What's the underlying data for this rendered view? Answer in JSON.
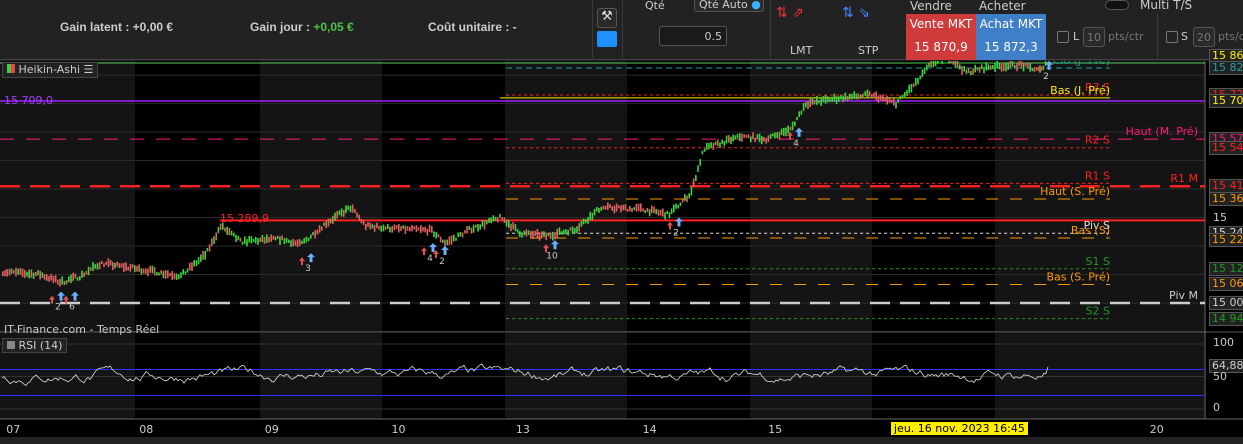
{
  "toolbar": {
    "gain_latent": "Gain latent : +0,00 €",
    "gain_jour_label": "Gain jour : ",
    "gain_jour_value": "+0,05 €",
    "cout_unitaire": "Coût unitaire : -",
    "qte_label": "Qté",
    "qte_auto": "Qté Auto",
    "qte_value": "0.5",
    "lmt": "LMT",
    "stp": "STP",
    "vendre": "Vendre",
    "acheter": "Acheter",
    "vente_mkt": "Vente MKT",
    "vente_price": "15 870,9",
    "achat_mkt": "Achat MKT",
    "achat_price": "15 872,3",
    "multi_ts": "Multi T/S",
    "l_label": "L",
    "l_value": "10",
    "s_label": "S",
    "s_value": "20",
    "pts_ctr": "pts/ctr"
  },
  "chart": {
    "type_label": "Heikin-Ashi",
    "source": "IT-Finance.com - Temps Réel",
    "rsi_label": "RSI (14)",
    "rsi_value": "64,88",
    "rsi_ticks": [
      "100",
      "50",
      "0"
    ],
    "level_left": "15 709,0",
    "level_mid": "15 289,9",
    "levels": [
      {
        "label": "Clo (J. Pré)",
        "price": 15825,
        "color": "#1aa3a3",
        "dash": "6,4",
        "from": 0.42
      },
      {
        "label": "R3 S",
        "price": 15730,
        "color": "#ff2020",
        "dash": "3,3",
        "from": 0.42
      },
      {
        "label": "Bas (J. Pré)",
        "price": 15720,
        "color": "#ffee00",
        "dash": "",
        "from": 1
      },
      {
        "label": "Haut (M. Pré)",
        "price": 15575,
        "color": "#ff1a80",
        "dash": "14,12",
        "from": 0
      },
      {
        "label": "R2 S",
        "price": 15545,
        "color": "#ff2020",
        "dash": "3,3",
        "from": 0.42
      },
      {
        "label": "R1 S",
        "price": 15420,
        "color": "#ff2020",
        "dash": "3,3",
        "from": 0.42
      },
      {
        "label": "R1 M",
        "price": 15410,
        "color": "#ff2020",
        "dash": "20,10",
        "from": 0
      },
      {
        "label": "Haut (S. Pré)",
        "price": 15365,
        "color": "#ff9900",
        "dash": "12,12",
        "from": 0.42
      },
      {
        "label": "Piv S",
        "price": 15245,
        "color": "#dddddd",
        "dash": "3,3",
        "from": 0.42
      },
      {
        "label": "Bas (S)",
        "price": 15228,
        "color": "#ff9900",
        "dash": "12,12",
        "from": 0.42
      },
      {
        "label": "S1 S",
        "price": 15120,
        "color": "#1f9a1f",
        "dash": "3,3",
        "from": 0.42
      },
      {
        "label": "Bas (S. Pré)",
        "price": 15065,
        "color": "#ff9900",
        "dash": "12,12",
        "from": 0.42
      },
      {
        "label": "Piv M",
        "price": 15000,
        "color": "#cccccc",
        "dash": "20,10",
        "from": 0
      },
      {
        "label": "S2 S",
        "price": 14945,
        "color": "#1f9a1f",
        "dash": "3,3",
        "from": 0.42
      }
    ],
    "price_boxes": [
      {
        "text": "15 86",
        "color": "#ffee00",
        "price": 15868
      },
      {
        "text": "15 82",
        "color": "#1aa3a3",
        "price": 15825
      },
      {
        "text": "15 72",
        "color": "#ff2020",
        "price": 15730
      },
      {
        "text": "15 70",
        "color": "#ffee00",
        "price": 15709
      },
      {
        "text": "15 57",
        "color": "#ff1a80",
        "price": 15575
      },
      {
        "text": "15 54",
        "color": "#ff2020",
        "price": 15545
      },
      {
        "text": "15 41",
        "color": "#ff2020",
        "price": 15410
      },
      {
        "text": "15 36",
        "color": "#ff9900",
        "price": 15365
      },
      {
        "text": "15 30",
        "color": "#cccccc",
        "price": 15300,
        "plain": true
      },
      {
        "text": "15 24",
        "color": "#dddddd",
        "price": 15245
      },
      {
        "text": "15 22",
        "color": "#ff9900",
        "price": 15220
      },
      {
        "text": "15 12",
        "color": "#1f9a1f",
        "price": 15120
      },
      {
        "text": "15 06",
        "color": "#ff9900",
        "price": 15065
      },
      {
        "text": "15 00",
        "color": "#cccccc",
        "price": 15000
      },
      {
        "text": "14 94",
        "color": "#1f9a1f",
        "price": 14945
      }
    ],
    "dates": [
      {
        "t": "07",
        "x": 0.005
      },
      {
        "t": "08",
        "x": 0.112
      },
      {
        "t": "09",
        "x": 0.213
      },
      {
        "t": "10",
        "x": 0.315
      },
      {
        "t": "13",
        "x": 0.415
      },
      {
        "t": "14",
        "x": 0.517
      },
      {
        "t": "15",
        "x": 0.618
      },
      {
        "t": "16",
        "x": 0.719
      },
      {
        "t": "20",
        "x": 0.925
      }
    ],
    "crosshair_date": "jeu. 16 nov. 2023 16:45",
    "trade_marks": [
      {
        "t": "2",
        "x": 58,
        "p": 15005
      },
      {
        "t": "6",
        "x": 72,
        "p": 15005
      },
      {
        "t": "3",
        "x": 308,
        "p": 15140
      },
      {
        "t": "4",
        "x": 430,
        "p": 15175
      },
      {
        "t": "2",
        "x": 442,
        "p": 15165
      },
      {
        "t": "10",
        "x": 552,
        "p": 15185
      },
      {
        "t": "2",
        "x": 676,
        "p": 15265
      },
      {
        "t": "4",
        "x": 796,
        "p": 15580
      },
      {
        "t": "2",
        "x": 1046,
        "p": 15815
      }
    ],
    "series": [
      [
        0,
        15110
      ],
      [
        40,
        15100
      ],
      [
        60,
        15072
      ],
      [
        80,
        15095
      ],
      [
        100,
        15140
      ],
      [
        140,
        15118
      ],
      [
        180,
        15095
      ],
      [
        205,
        15170
      ],
      [
        220,
        15270
      ],
      [
        240,
        15215
      ],
      [
        280,
        15225
      ],
      [
        300,
        15205
      ],
      [
        325,
        15280
      ],
      [
        350,
        15335
      ],
      [
        365,
        15270
      ],
      [
        400,
        15260
      ],
      [
        430,
        15255
      ],
      [
        445,
        15210
      ],
      [
        470,
        15260
      ],
      [
        500,
        15300
      ],
      [
        520,
        15245
      ],
      [
        545,
        15235
      ],
      [
        575,
        15260
      ],
      [
        600,
        15335
      ],
      [
        640,
        15330
      ],
      [
        668,
        15310
      ],
      [
        690,
        15385
      ],
      [
        703,
        15540
      ],
      [
        740,
        15585
      ],
      [
        765,
        15575
      ],
      [
        790,
        15610
      ],
      [
        805,
        15700
      ],
      [
        840,
        15720
      ],
      [
        870,
        15730
      ],
      [
        895,
        15700
      ],
      [
        915,
        15770
      ],
      [
        930,
        15840
      ],
      [
        950,
        15860
      ],
      [
        965,
        15810
      ],
      [
        990,
        15830
      ],
      [
        1020,
        15835
      ],
      [
        1040,
        15815
      ],
      [
        1048,
        15868
      ]
    ]
  }
}
